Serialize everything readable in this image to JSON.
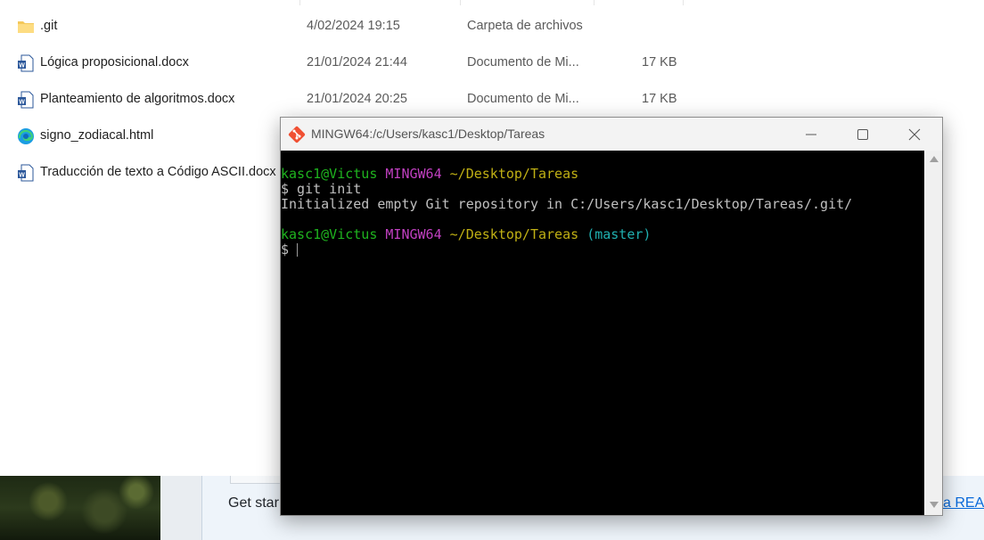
{
  "explorer": {
    "files": [
      {
        "name": ".git",
        "date": "4/02/2024 19:15",
        "type": "Carpeta de archivos",
        "size": "",
        "icon": "folder-icon"
      },
      {
        "name": "Lógica proposicional.docx",
        "date": "21/01/2024 21:44",
        "type": "Documento de Mi...",
        "size": "17 KB",
        "icon": "word-doc-icon"
      },
      {
        "name": "Planteamiento de algoritmos.docx",
        "date": "21/01/2024 20:25",
        "type": "Documento de Mi...",
        "size": "17 KB",
        "icon": "word-doc-icon"
      },
      {
        "name": "signo_zodiacal.html",
        "date": "",
        "type": "",
        "size": "",
        "icon": "edge-html-icon"
      },
      {
        "name": "Traducción de texto a Código ASCII.docx",
        "date": "",
        "type": "",
        "size": "",
        "icon": "word-doc-icon"
      }
    ]
  },
  "background": {
    "text_partial": "Get star",
    "link_partial": "a READ"
  },
  "terminal": {
    "title": "MINGW64:/c/Users/kasc1/Desktop/Tareas",
    "prompt1": {
      "user": "kasc1@Victus",
      "system": "MINGW64",
      "path": "~/Desktop/Tareas"
    },
    "command": "$ git init",
    "output": "Initialized empty Git repository in C:/Users/kasc1/Desktop/Tareas/.git/",
    "prompt2": {
      "user": "kasc1@Victus",
      "system": "MINGW64",
      "path": "~/Desktop/Tareas",
      "branch": "(master)"
    },
    "input_prompt": "$"
  },
  "colors": {
    "prompt_user": "#1fb41f",
    "prompt_system": "#c040c0",
    "prompt_path": "#c0b014",
    "prompt_branch": "#20b0b0",
    "terminal_bg": "#000000"
  }
}
